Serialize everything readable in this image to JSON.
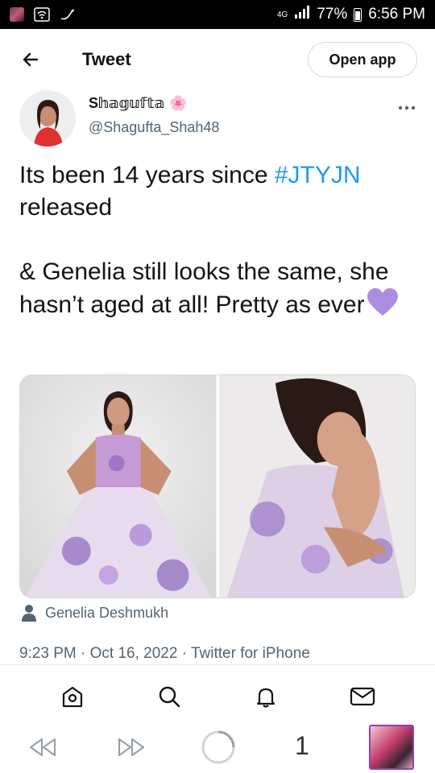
{
  "status_bar": {
    "network": "4G",
    "battery": "77%",
    "time": "6:56 PM"
  },
  "header": {
    "title": "Tweet",
    "open_app": "Open app"
  },
  "tweet": {
    "author_name": "S𝕙𝕒𝕘𝕦𝕗𝕥𝕒",
    "author_emoji": "🌸",
    "author_handle": "@Shagufta_Shah48",
    "text_part1": "Its been 14 years since ",
    "hashtag": "#JTYJN",
    "text_part2": "released",
    "text_para2": "& Genelia still looks the same, she hasn’t aged at all! Pretty as ever",
    "tagged_user": "Genelia Deshmukh",
    "meta": "9:23 PM · Oct 16, 2022 · Twitter for iPhone"
  },
  "icons": {
    "back": "arrow-left-icon",
    "more": "more-horizontal-icon",
    "heart": "purple-heart-emoji",
    "tag": "person-icon",
    "home": "home-icon",
    "search": "search-icon",
    "notifications": "bell-icon",
    "messages": "mail-icon"
  },
  "browser": {
    "tab_count": "1"
  },
  "colors": {
    "hashtag": "#1d9bf0",
    "secondary_text": "#536471",
    "heart": "#ac8de0",
    "thumb_border": "#8d3fbf"
  }
}
